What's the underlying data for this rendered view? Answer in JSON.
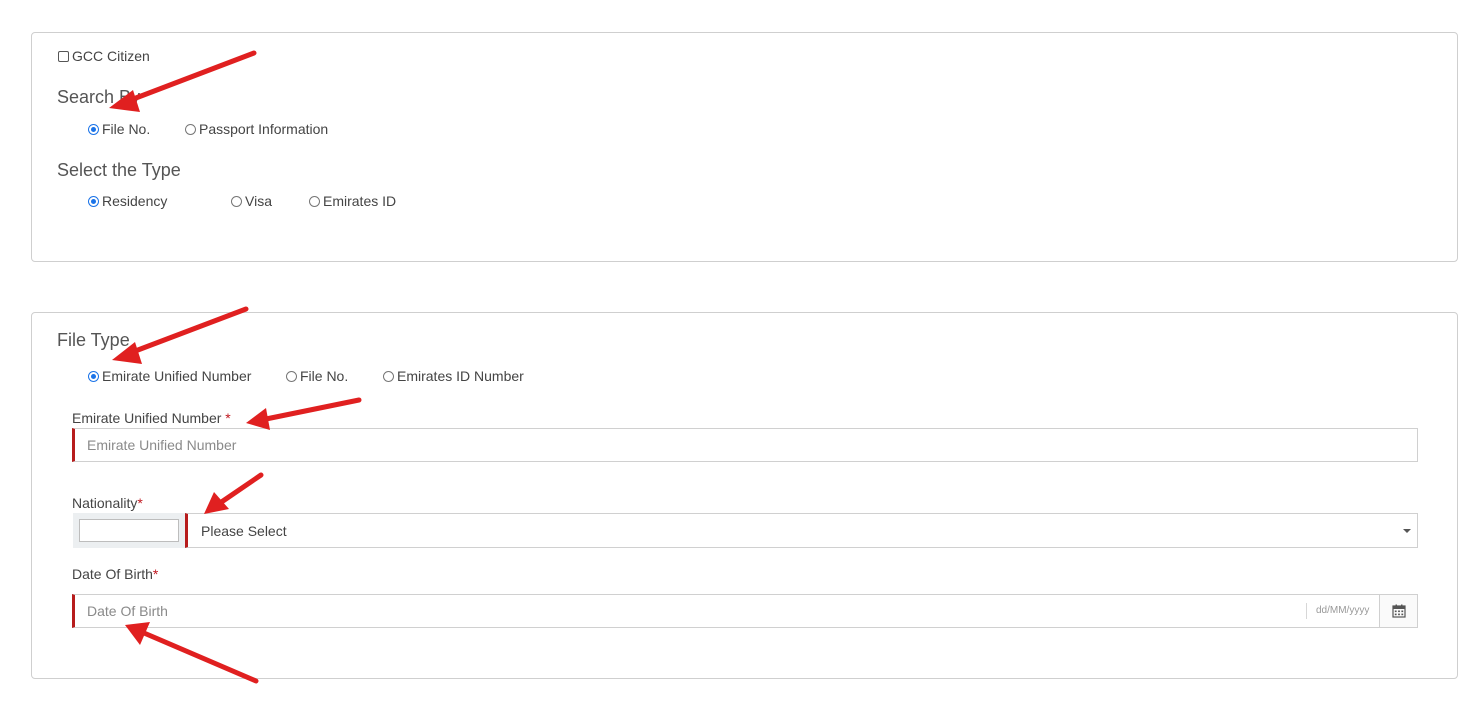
{
  "search_panel": {
    "gcc_citizen_label": "GCC Citizen",
    "gcc_citizen_checked": false,
    "search_by": {
      "heading": "Search By",
      "options": [
        {
          "label": "File No.",
          "selected": true
        },
        {
          "label": "Passport Information",
          "selected": false
        }
      ]
    },
    "select_type": {
      "heading": "Select the Type",
      "options": [
        {
          "label": "Residency",
          "selected": true
        },
        {
          "label": "Visa",
          "selected": false
        },
        {
          "label": "Emirates ID",
          "selected": false
        }
      ]
    }
  },
  "file_panel": {
    "file_type": {
      "heading": "File Type",
      "options": [
        {
          "label": "Emirate Unified Number",
          "selected": true
        },
        {
          "label": "File No.",
          "selected": false
        },
        {
          "label": "Emirates ID Number",
          "selected": false
        }
      ]
    },
    "unified_number": {
      "label": "Emirate Unified Number",
      "required_mark": "*",
      "placeholder": "Emirate Unified Number",
      "value": ""
    },
    "nationality": {
      "label": "Nationality",
      "required_mark": "*",
      "code_value": "",
      "selected": "Please Select"
    },
    "date_of_birth": {
      "label": "Date Of Birth",
      "required_mark": "*",
      "placeholder": "Date Of Birth",
      "format_hint": "dd/MM/yyyy",
      "icon": "calendar-icon"
    }
  },
  "theme": {
    "accent": "#1a73e8",
    "required_color": "#c0171f",
    "annotation_arrow_color": "#e02020"
  }
}
